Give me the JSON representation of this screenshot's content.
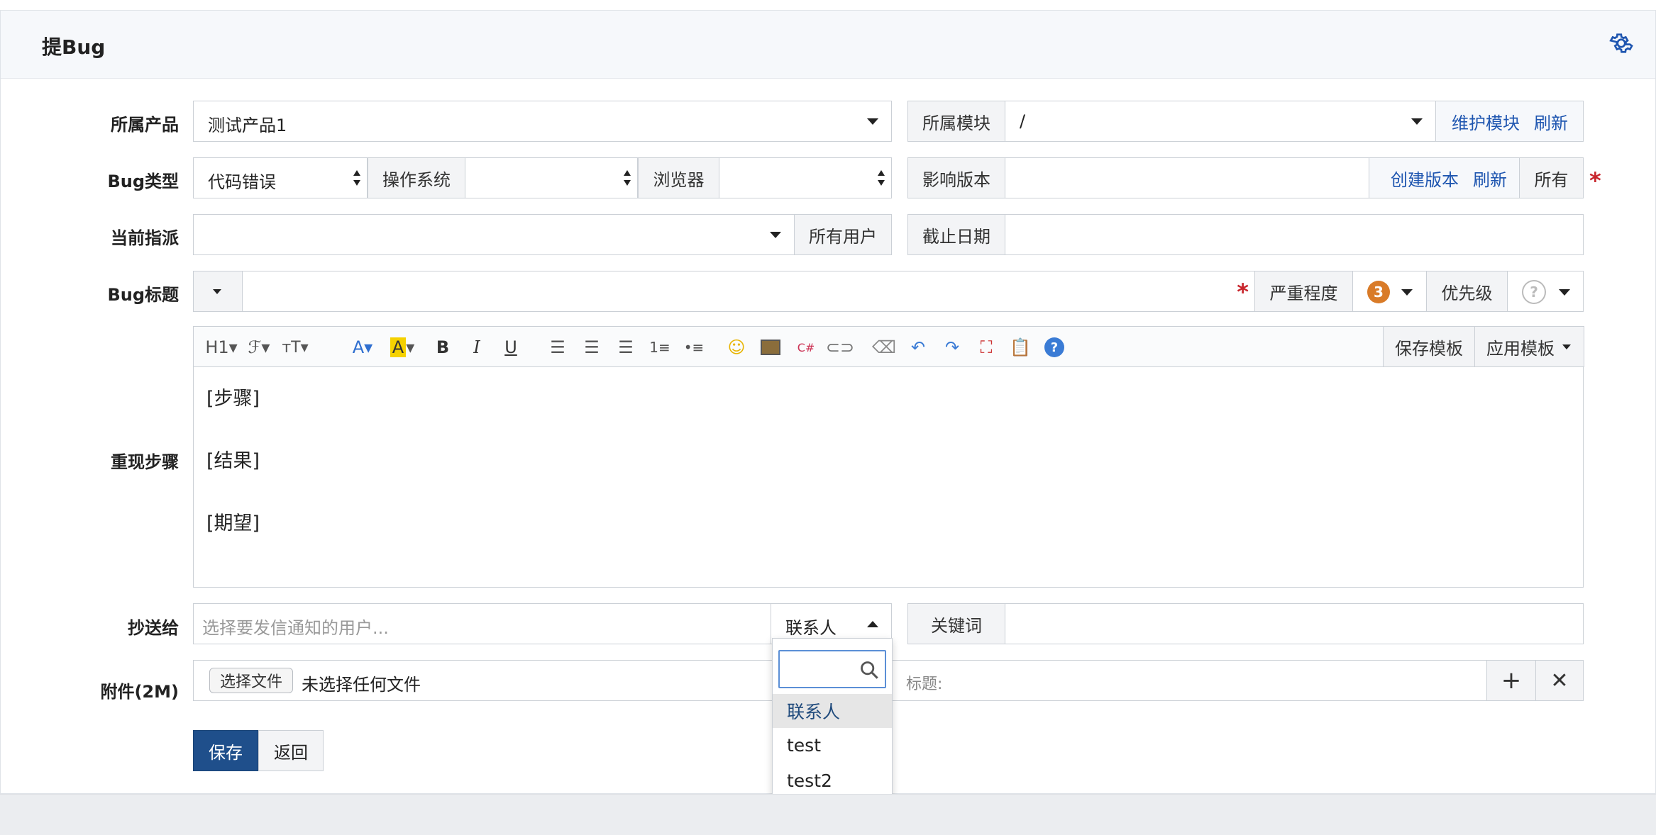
{
  "header": {
    "title": "提Bug"
  },
  "form": {
    "product": {
      "label": "所属产品",
      "value": "测试产品1"
    },
    "module": {
      "label": "所属模块",
      "value": "/",
      "maintain_link": "维护模块",
      "refresh_link": "刷新"
    },
    "bug_type": {
      "label": "Bug类型",
      "value": "代码错误"
    },
    "os": {
      "label": "操作系统",
      "value": ""
    },
    "browser": {
      "label": "浏览器",
      "value": ""
    },
    "affected_version": {
      "label": "影响版本",
      "create_link": "创建版本",
      "refresh_link": "刷新",
      "all_button": "所有"
    },
    "assignee": {
      "label": "当前指派",
      "value": "",
      "all_users_button": "所有用户"
    },
    "deadline": {
      "label": "截止日期",
      "value": ""
    },
    "title": {
      "label": "Bug标题",
      "value": ""
    },
    "severity": {
      "label": "严重程度",
      "value": "3"
    },
    "priority": {
      "label": "优先级",
      "value": "?"
    },
    "steps": {
      "label": "重现步骤",
      "save_template": "保存模板",
      "apply_template": "应用模板",
      "lines": [
        "[步骤]",
        "[结果]",
        "[期望]"
      ]
    },
    "cc": {
      "label": "抄送给",
      "placeholder": "选择要发信通知的用户...",
      "contacts_label": "联系人"
    },
    "keywords": {
      "label": "关键词",
      "value": ""
    },
    "attachment": {
      "label": "附件(2M)",
      "choose_button": "选择文件",
      "no_file": "未选择任何文件",
      "title_label": "标题:"
    }
  },
  "contacts_dropdown": {
    "items": [
      "联系人",
      "test",
      "test2"
    ]
  },
  "actions": {
    "save": "保存",
    "back": "返回"
  },
  "colors": {
    "primary": "#1f4f8b",
    "link": "#1f56b0",
    "required": "#c8252c",
    "severity_badge": "#d97b28"
  }
}
